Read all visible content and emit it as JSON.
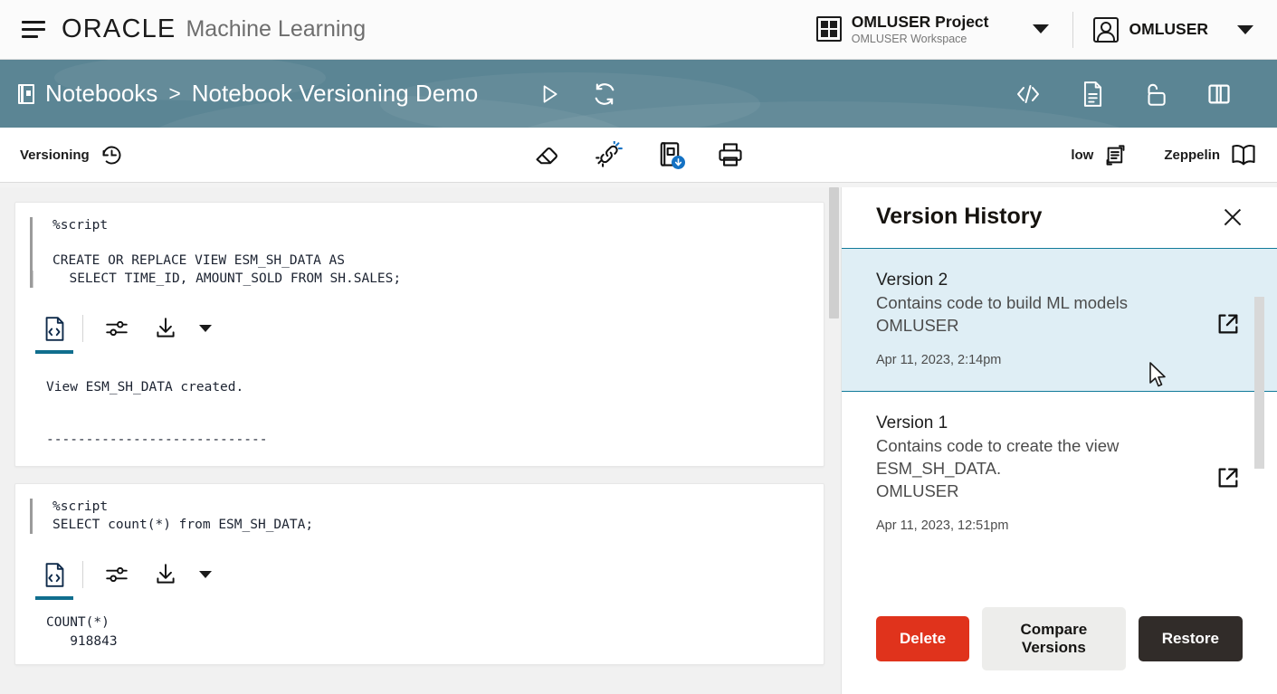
{
  "header": {
    "menu_icon": "hamburger-icon",
    "brand": "ORACLE",
    "product": "Machine Learning",
    "project": {
      "icon": "grid-icon",
      "title": "OMLUSER Project",
      "subtitle": "OMLUSER Workspace",
      "caret": "chevron-down-icon"
    },
    "user": {
      "icon": "user-avatar-icon",
      "name": "OMLUSER",
      "caret": "chevron-down-icon"
    }
  },
  "breadcrumb": {
    "icon": "notebook-icon",
    "parent": "Notebooks",
    "separator": ">",
    "current": "Notebook Versioning Demo",
    "bg_color": "#5b8594",
    "actions": [
      {
        "name": "run-notebook-icon",
        "glyph": "play-triangle"
      },
      {
        "name": "refresh-icon",
        "glyph": "refresh-arrows"
      }
    ],
    "right_actions": [
      {
        "name": "code-view-icon",
        "glyph": "angle-brackets"
      },
      {
        "name": "document-icon",
        "glyph": "page-lines"
      },
      {
        "name": "unlock-icon",
        "glyph": "padlock-open"
      },
      {
        "name": "split-layout-icon",
        "glyph": "two-columns"
      }
    ]
  },
  "toolbar": {
    "versioning_label": "Versioning",
    "versioning_icon": "history-clock-icon",
    "center_icons": [
      {
        "name": "eraser-icon"
      },
      {
        "name": "clear-output-icon"
      },
      {
        "name": "export-notebook-icon"
      },
      {
        "name": "print-icon"
      }
    ],
    "mode_label": "low",
    "mode_icon": "flow-list-icon",
    "interpreter_label": "Zeppelin",
    "interpreter_icon": "open-book-icon"
  },
  "notebook": {
    "cells": [
      {
        "code": [
          "%script",
          "",
          "CREATE OR REPLACE VIEW ESM_SH_DATA AS",
          "  SELECT TIME_ID, AMOUNT_SOLD FROM SH.SALES;"
        ],
        "tools": [
          {
            "name": "code-toggle-icon",
            "active": true
          },
          {
            "name": "settings-sliders-icon",
            "active": false
          },
          {
            "name": "download-icon",
            "active": false
          },
          {
            "name": "download-caret-icon",
            "active": false
          }
        ],
        "output": [
          "View ESM_SH_DATA created.",
          "",
          "----------------------------"
        ]
      },
      {
        "code": [
          "%script",
          "SELECT count(*) from ESM_SH_DATA;"
        ],
        "tools": [
          {
            "name": "code-toggle-icon",
            "active": true
          },
          {
            "name": "settings-sliders-icon",
            "active": false
          },
          {
            "name": "download-icon",
            "active": false
          },
          {
            "name": "download-caret-icon",
            "active": false
          }
        ],
        "output": [
          "COUNT(*)",
          "   918843"
        ]
      }
    ]
  },
  "version_history": {
    "title": "Version History",
    "close_icon": "close-icon",
    "items": [
      {
        "version": "Version 2",
        "description": "Contains code to build ML models",
        "user": "OMLUSER",
        "date": "Apr 11, 2023, 2:14pm",
        "open_icon": "external-link-icon",
        "selected": true
      },
      {
        "version": "Version 1",
        "description": "Contains code to create the view ESM_SH_DATA.",
        "user": "OMLUSER",
        "date": "Apr 11, 2023, 12:51pm",
        "open_icon": "external-link-icon",
        "selected": false
      }
    ],
    "buttons": {
      "delete": "Delete",
      "compare": "Compare Versions",
      "restore": "Restore"
    },
    "colors": {
      "selected_bg": "#dfeef5",
      "divider": "#117b99",
      "delete_bg": "#e0331c",
      "compare_bg": "#ededeb",
      "restore_bg": "#312c29"
    }
  }
}
